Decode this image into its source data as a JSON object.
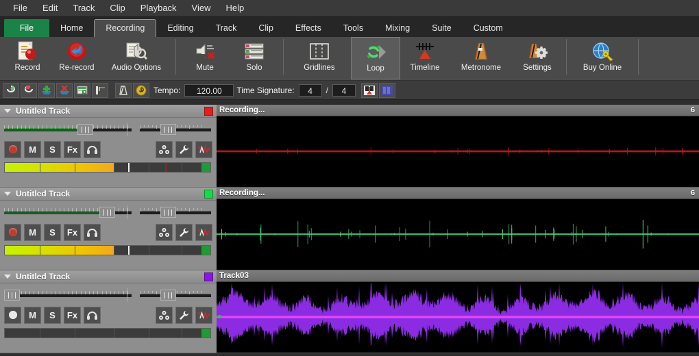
{
  "menubar": {
    "items": [
      {
        "label": "File"
      },
      {
        "label": "Edit"
      },
      {
        "label": "Track"
      },
      {
        "label": "Clip"
      },
      {
        "label": "Playback"
      },
      {
        "label": "View"
      },
      {
        "label": "Help"
      }
    ]
  },
  "ribbon": {
    "tabs": [
      {
        "label": "File",
        "state": "file"
      },
      {
        "label": "Home",
        "state": "normal"
      },
      {
        "label": "Recording",
        "state": "active"
      },
      {
        "label": "Editing",
        "state": "normal"
      },
      {
        "label": "Track",
        "state": "normal"
      },
      {
        "label": "Clip",
        "state": "normal"
      },
      {
        "label": "Effects",
        "state": "normal"
      },
      {
        "label": "Tools",
        "state": "normal"
      },
      {
        "label": "Mixing",
        "state": "normal"
      },
      {
        "label": "Suite",
        "state": "normal"
      },
      {
        "label": "Custom",
        "state": "normal"
      }
    ],
    "buttons": [
      {
        "label": "Record",
        "icon": "record-icon",
        "selected": false
      },
      {
        "label": "Re-record",
        "icon": "re-record-icon",
        "selected": false
      },
      {
        "label": "Audio Options",
        "icon": "audio-options-icon",
        "selected": false
      },
      {
        "label": "Mute",
        "icon": "mute-icon",
        "selected": false
      },
      {
        "label": "Solo",
        "icon": "solo-icon",
        "selected": false
      },
      {
        "label": "Gridlines",
        "icon": "gridlines-icon",
        "selected": false
      },
      {
        "label": "Loop",
        "icon": "loop-icon",
        "selected": true
      },
      {
        "label": "Timeline",
        "icon": "timeline-icon",
        "selected": false
      },
      {
        "label": "Metronome",
        "icon": "metronome-icon",
        "selected": false
      },
      {
        "label": "Settings",
        "icon": "settings-icon",
        "selected": false
      },
      {
        "label": "Buy Online",
        "icon": "buy-online-icon",
        "selected": false
      }
    ]
  },
  "toolbar": {
    "icons": [
      {
        "name": "loop-green-icon"
      },
      {
        "name": "loop-red-icon"
      },
      {
        "name": "add-track-icon"
      },
      {
        "name": "delete-track-icon"
      },
      {
        "name": "import-clip-icon"
      },
      {
        "name": "split-clip-icon"
      },
      {
        "name": "metronome-small-icon"
      },
      {
        "name": "tempo-icon"
      }
    ],
    "tempo_label": "Tempo:",
    "tempo_value": "120.00",
    "time_signature_label": "Time Signature:",
    "time_signature_numerator": "4",
    "time_signature_separator": "/",
    "time_signature_denominator": "4",
    "right_icons": [
      {
        "name": "metronome-toggle-icon"
      },
      {
        "name": "view-mode-icon"
      }
    ]
  },
  "tracks": [
    {
      "name": "Untitled Track",
      "color": "#e02020",
      "armed": true,
      "arm_color": "#c43a2a",
      "volume_percent": 61,
      "pan_percent": 50,
      "meter_fill_percent": 53,
      "meter_white_percent": 60,
      "meter_red_percent": 78,
      "buttons": [
        "M",
        "S",
        "Fx"
      ],
      "headphone_icon": "headphone-icon",
      "right_icons": [
        "routing-icon",
        "wrench-icon",
        "automation-icon"
      ],
      "clip": {
        "name": "Recording...",
        "right_label": "6",
        "wave_color": "#d01818",
        "wave_type": "flat-red"
      }
    },
    {
      "name": "Untitled Track",
      "color": "#19d94a",
      "armed": true,
      "arm_color": "#c43a2a",
      "volume_percent": 78,
      "pan_percent": 50,
      "meter_fill_percent": 53,
      "meter_white_percent": 60,
      "meter_red_percent": 96,
      "buttons": [
        "M",
        "S",
        "Fx"
      ],
      "headphone_icon": "headphone-icon",
      "right_icons": [
        "routing-icon",
        "wrench-icon",
        "automation-icon"
      ],
      "clip": {
        "name": "Recording...",
        "right_label": "6",
        "wave_color": "#46d27a",
        "wave_type": "spiky-green"
      }
    },
    {
      "name": "Untitled Track",
      "color": "#8a16e0",
      "armed": false,
      "arm_color": "#e8e8e8",
      "volume_percent": 0,
      "pan_percent": 50,
      "meter_fill_percent": 0,
      "meter_white_percent": -1,
      "meter_red_percent": -1,
      "buttons": [
        "M",
        "S",
        "Fx"
      ],
      "headphone_icon": "headphone-icon",
      "right_icons": [
        "routing-icon",
        "wrench-icon",
        "automation-icon"
      ],
      "clip": {
        "name": "Track03",
        "right_label": "",
        "wave_color": "#8b2be2",
        "wave_type": "dense-purple"
      }
    }
  ]
}
